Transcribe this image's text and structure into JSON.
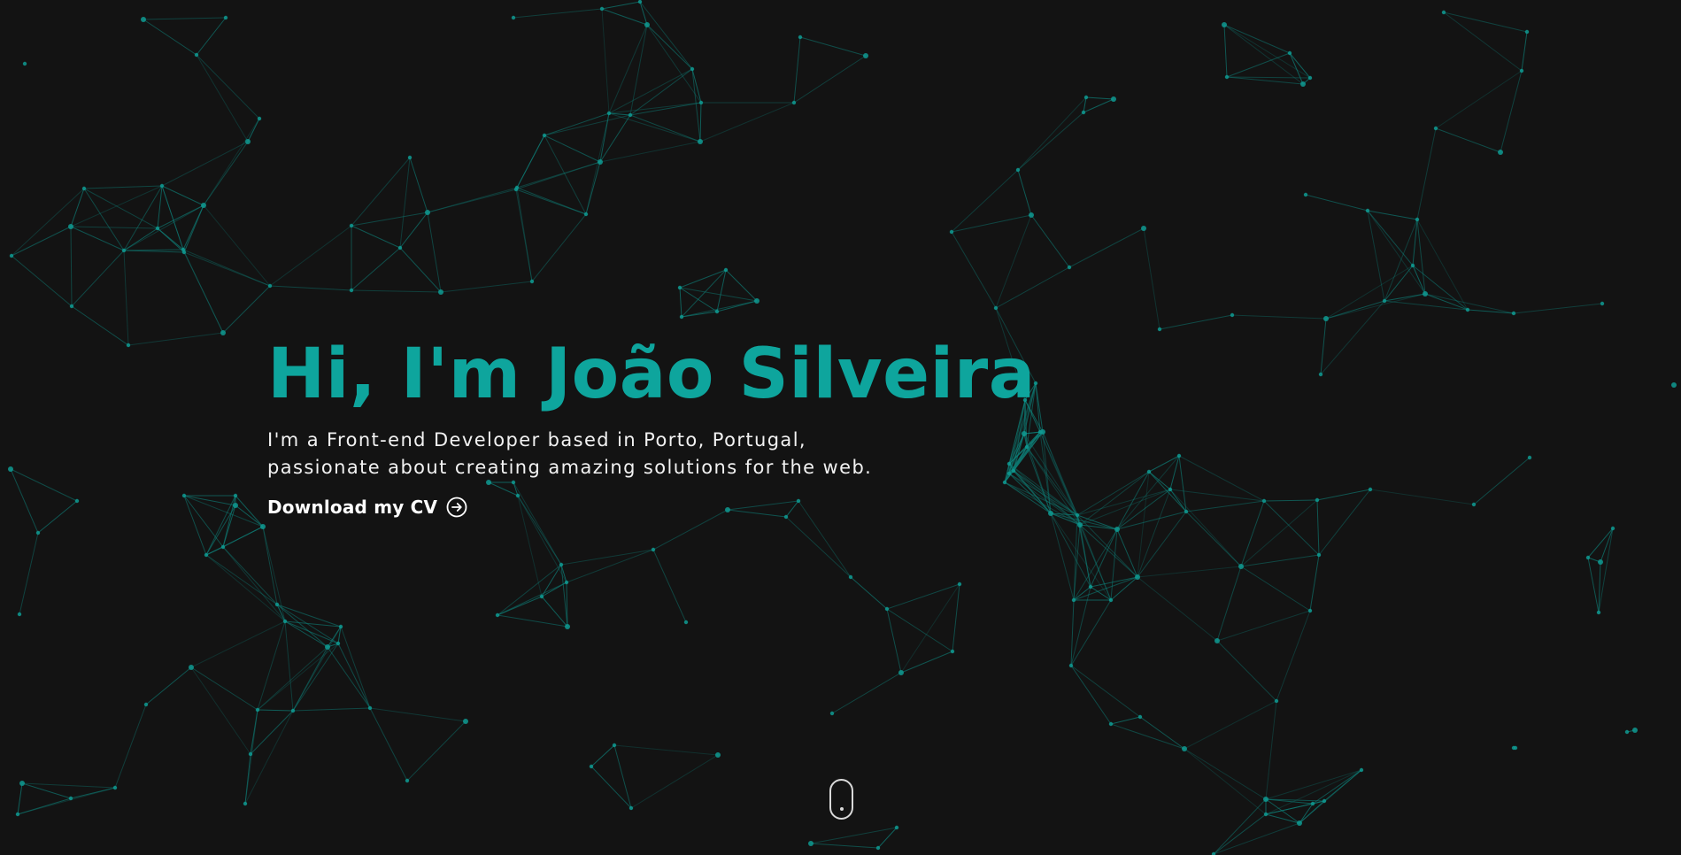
{
  "theme": {
    "background": "#131313",
    "accent": "#0ea59d",
    "text": "#f2f2f2",
    "network_color": "#0e7f78"
  },
  "hero": {
    "title": "Hi, I'm João Silveira",
    "subtitle_line1": "I'm a Front-end Developer based in Porto, Portugal,",
    "subtitle_line2": "passionate about creating amazing solutions for the web.",
    "cta_label": "Download my CV",
    "cta_icon": "arrow-right-circle-icon"
  },
  "scroll_indicator": {
    "icon": "mouse-scroll-icon"
  }
}
